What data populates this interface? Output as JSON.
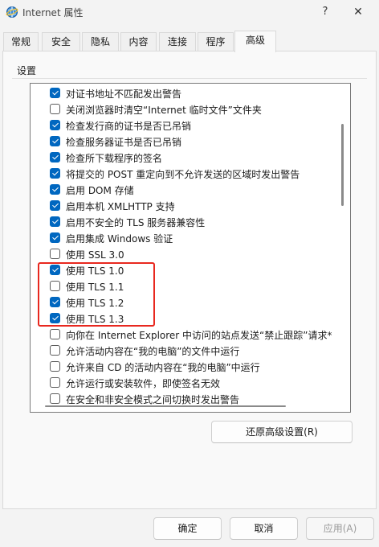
{
  "window": {
    "title": "Internet 属性",
    "help_glyph": "?",
    "close_glyph": "✕"
  },
  "tabs": [
    {
      "label": "常规",
      "active": false
    },
    {
      "label": "安全",
      "active": false
    },
    {
      "label": "隐私",
      "active": false
    },
    {
      "label": "内容",
      "active": false
    },
    {
      "label": "连接",
      "active": false
    },
    {
      "label": "程序",
      "active": false
    },
    {
      "label": "高级",
      "active": true
    }
  ],
  "settings": {
    "group_label": "设置",
    "items": [
      {
        "label": "对证书地址不匹配发出警告",
        "checked": true
      },
      {
        "label": "关闭浏览器时清空“Internet 临时文件”文件夹",
        "checked": false
      },
      {
        "label": "检查发行商的证书是否已吊销",
        "checked": true
      },
      {
        "label": "检查服务器证书是否已吊销",
        "checked": true
      },
      {
        "label": "检查所下载程序的签名",
        "checked": true
      },
      {
        "label": "将提交的 POST 重定向到不允许发送的区域时发出警告",
        "checked": true
      },
      {
        "label": "启用 DOM 存储",
        "checked": true
      },
      {
        "label": "启用本机 XMLHTTP 支持",
        "checked": true
      },
      {
        "label": "启用不安全的 TLS 服务器兼容性",
        "checked": true
      },
      {
        "label": "启用集成 Windows 验证",
        "checked": true
      },
      {
        "label": "使用 SSL 3.0",
        "checked": false
      },
      {
        "label": "使用 TLS 1.0",
        "checked": true
      },
      {
        "label": "使用 TLS 1.1",
        "checked": false
      },
      {
        "label": "使用 TLS 1.2",
        "checked": true
      },
      {
        "label": "使用 TLS 1.3",
        "checked": true
      },
      {
        "label": "向你在 Internet Explorer 中访问的站点发送“禁止跟踪”请求*",
        "checked": false
      },
      {
        "label": "允许活动内容在“我的电脑”的文件中运行",
        "checked": false
      },
      {
        "label": "允许来自 CD 的活动内容在“我的电脑”中运行",
        "checked": false
      },
      {
        "label": "允许运行或安装软件，即使签名无效",
        "checked": false
      },
      {
        "label": "在安全和非安全模式之间切换时发出警告",
        "checked": false
      }
    ]
  },
  "buttons": {
    "restore": "还原高级设置(R)",
    "ok": "确定",
    "cancel": "取消",
    "apply": "应用(A)"
  },
  "colors": {
    "checkbox_checked": "#0067c0",
    "highlight_box": "#e8281f"
  }
}
